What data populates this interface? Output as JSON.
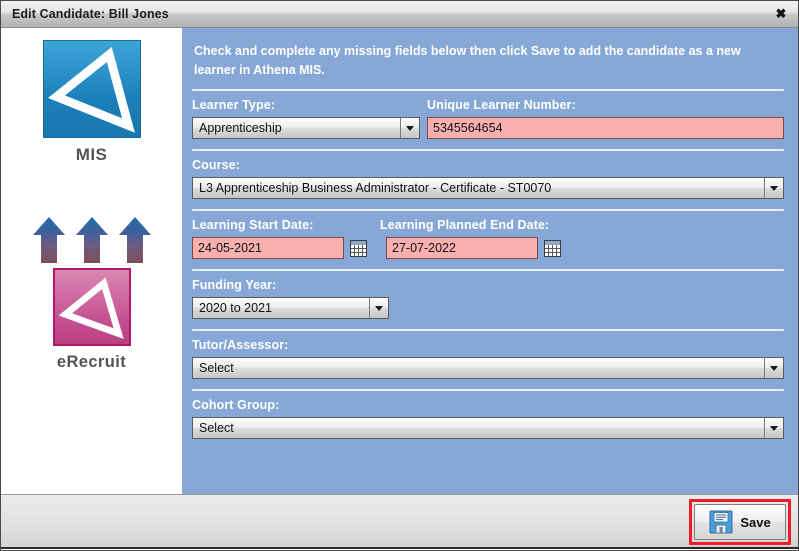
{
  "window": {
    "title": "Edit Candidate: Bill Jones",
    "close_label": "✖"
  },
  "sidebar": {
    "mis": {
      "caption": "MIS",
      "icon": "triangle-logo-icon"
    },
    "arrows": {
      "icon": "up-arrow-icon",
      "count": 3
    },
    "erecruit": {
      "caption": "eRecruit",
      "icon": "triangle-logo-icon"
    }
  },
  "form": {
    "intro": "Check and complete any missing fields below then click Save to add the candidate as a new learner in Athena MIS.",
    "learner_type": {
      "label": "Learner Type:",
      "value": "Apprenticeship"
    },
    "uln": {
      "label": "Unique Learner Number:",
      "value": "5345564654"
    },
    "course": {
      "label": "Course:",
      "value": "L3 Apprenticeship Business Administrator - Certificate - ST0070"
    },
    "start_date": {
      "label": "Learning Start Date:",
      "value": "24-05-2021"
    },
    "end_date": {
      "label": "Learning Planned End Date:",
      "value": "27-07-2022"
    },
    "funding_year": {
      "label": "Funding Year:",
      "value": "2020 to 2021"
    },
    "tutor": {
      "label": "Tutor/Assessor:",
      "value": "Select"
    },
    "cohort": {
      "label": "Cohort Group:",
      "value": "Select"
    }
  },
  "footer": {
    "save_label": "Save"
  },
  "colors": {
    "panel_blue": "#87a8d7",
    "required_pink": "#f7b0ad",
    "highlight_red": "#ee1c25",
    "mis_blue": "#1d7fb8",
    "erecruit_pink": "#c4508f"
  }
}
